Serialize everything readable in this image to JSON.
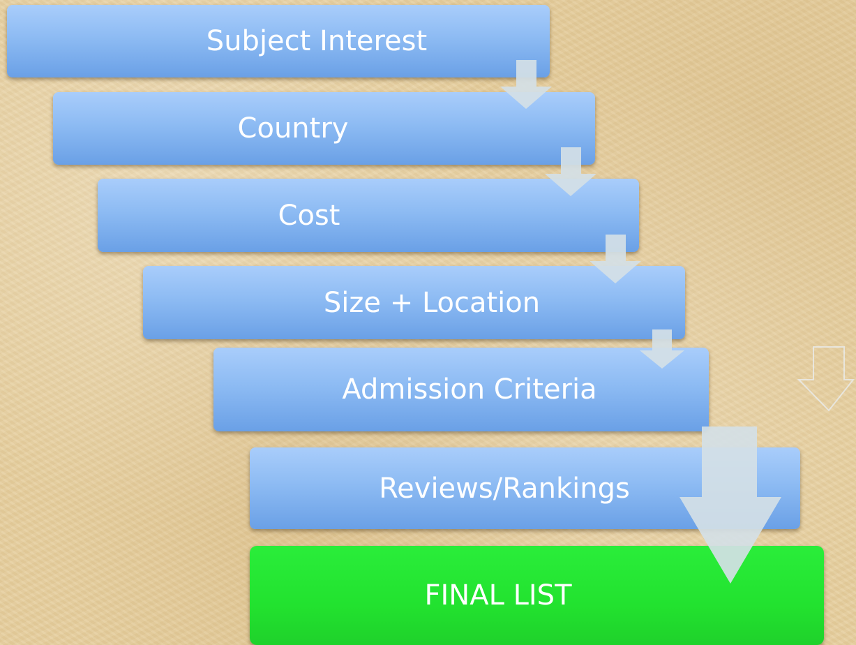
{
  "steps": [
    {
      "label": "Subject Interest"
    },
    {
      "label": "Country"
    },
    {
      "label": "Cost"
    },
    {
      "label": "Size + Location"
    },
    {
      "label": "Admission Criteria"
    },
    {
      "label": "Reviews/Rankings"
    },
    {
      "label": "FINAL LIST"
    }
  ],
  "colors": {
    "step_fill": "#8dbbf3",
    "final_fill": "#22e22f",
    "arrow_fill": "#d4dfe6",
    "text": "#ffffff"
  },
  "icons": {
    "connector": "down-arrow-icon",
    "outline_connector": "down-arrow-outline-icon"
  }
}
